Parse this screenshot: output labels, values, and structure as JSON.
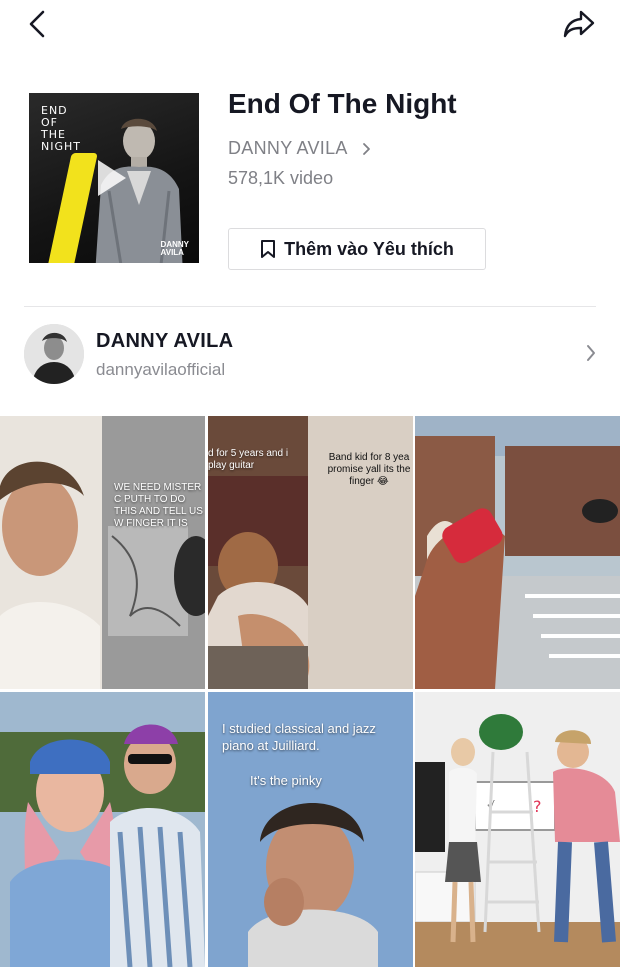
{
  "song": {
    "title": "End Of The Night",
    "artist": "DANNY AVILA",
    "video_count": "578,1K video",
    "favorite_label": "Thêm vào Yêu thích",
    "cover_title_lines": [
      "END",
      "OF",
      "THE",
      "NIGHT"
    ],
    "cover_brand_lines": [
      "DANNY",
      "AVILA"
    ]
  },
  "creator": {
    "name": "DANNY AVILA",
    "handle": "dannyavilaofficial"
  },
  "videos": [
    {
      "caption": "WE NEED MISTER C PUTH TO DO THIS AND TELL US W FINGER IT IS"
    },
    {
      "caption": "d for 5 years and i play guitar"
    },
    {
      "caption": "Band kid for 8 yea promise yall its the finger 😂"
    },
    {
      "caption": ""
    },
    {
      "caption": ""
    },
    {
      "caption": "I studied classical and jazz piano at Juilliard."
    },
    {
      "caption": "It's the pinky"
    },
    {
      "caption": ""
    }
  ],
  "icons": {
    "back": "back-arrow-icon",
    "share": "share-icon",
    "artist_chevron": "chevron-right-icon",
    "bookmark": "bookmark-icon",
    "play": "play-icon"
  },
  "colors": {
    "text_primary": "#161823",
    "text_secondary": "#7f8086",
    "divider": "#e6e6e8",
    "cover_accent": "#f2e21c"
  }
}
